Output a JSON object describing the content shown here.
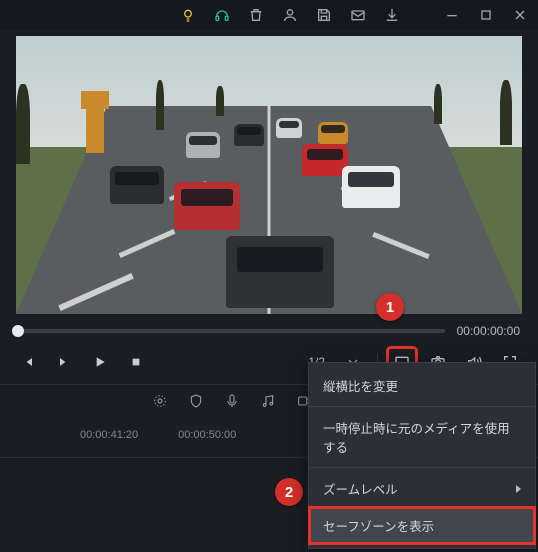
{
  "time_display": "00:00:00:00",
  "ratio": "1/2",
  "timeline": {
    "ticks": [
      "00:00:41:20",
      "00:00:50:00"
    ]
  },
  "callouts": {
    "one": "1",
    "two": "2"
  },
  "menu": {
    "change_aspect": "縦横比を変更",
    "use_original_on_pause": "一時停止時に元のメディアを使用する",
    "zoom_level": "ズームレベル",
    "show_safe_zone": "セーフゾーンを表示"
  }
}
